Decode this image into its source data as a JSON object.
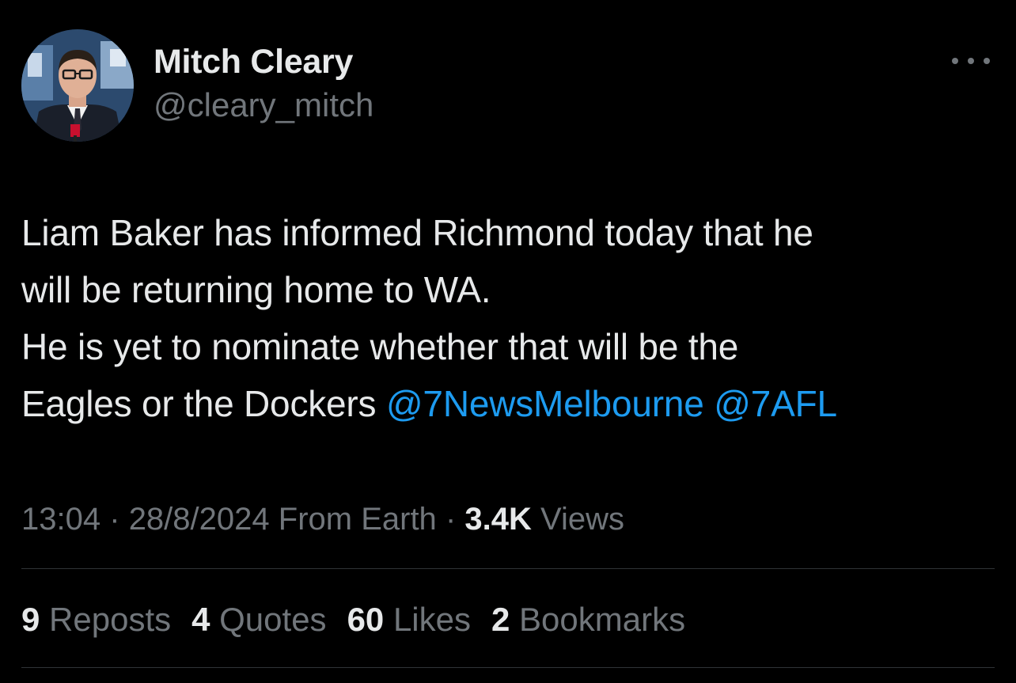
{
  "author": {
    "display_name": "Mitch Cleary",
    "handle": "@cleary_mitch"
  },
  "more_icon": "ellipsis-icon",
  "tweet": {
    "line1": "Liam Baker has informed Richmond today that he",
    "line2": "will be returning home to WA.",
    "line3": "He is yet to nominate whether that will be the",
    "line4": "Eagles or the Dockers",
    "mention1": "@7NewsMelbourne",
    "mention2": "@7AFL"
  },
  "meta": {
    "time": "13:04",
    "sep1": "·",
    "date": "28/8/2024",
    "source": "From Earth",
    "sep2": "·",
    "views_count": "3.4K",
    "views_label": "Views"
  },
  "stats": {
    "reposts_count": "9",
    "reposts_label": "Reposts",
    "quotes_count": "4",
    "quotes_label": "Quotes",
    "likes_count": "60",
    "likes_label": "Likes",
    "bookmarks_count": "2",
    "bookmarks_label": "Bookmarks"
  },
  "colors": {
    "background": "#000000",
    "text": "#e7e9ea",
    "secondary": "#71767b",
    "link": "#1d9bf0",
    "divider": "#2f3336"
  }
}
